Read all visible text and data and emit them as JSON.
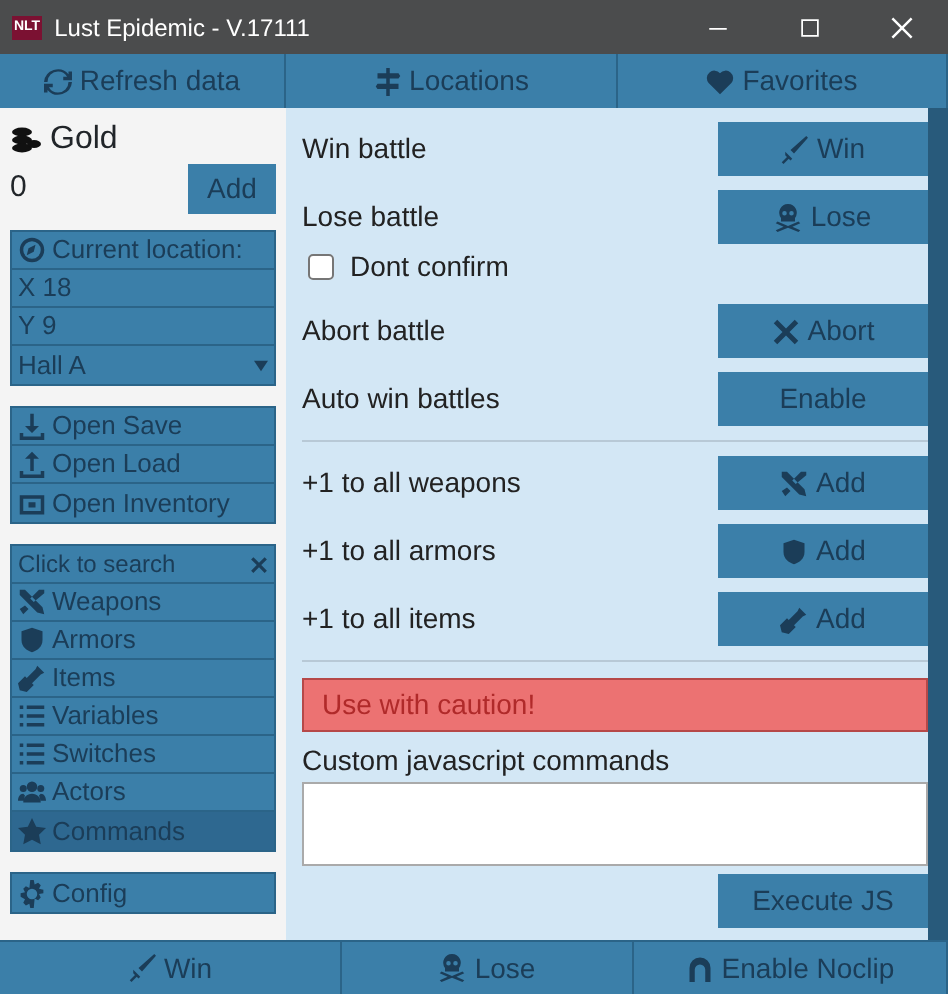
{
  "window": {
    "title": "Lust Epidemic - V.17111",
    "logo": "NLT"
  },
  "top_nav": [
    {
      "label": "Refresh data"
    },
    {
      "label": "Locations"
    },
    {
      "label": "Favorites"
    }
  ],
  "sidebar": {
    "gold": {
      "label": "Gold",
      "value": "0",
      "button": "Add"
    },
    "location": {
      "header": "Current location:",
      "x": "X 18",
      "y": "Y 9",
      "map": "Hall A"
    },
    "files": [
      {
        "label": "Open Save"
      },
      {
        "label": "Open Load"
      },
      {
        "label": "Open Inventory"
      }
    ],
    "search": {
      "placeholder": "Click to search"
    },
    "categories": [
      {
        "label": "Weapons",
        "selected": false
      },
      {
        "label": "Armors",
        "selected": false
      },
      {
        "label": "Items",
        "selected": false
      },
      {
        "label": "Variables",
        "selected": false
      },
      {
        "label": "Switches",
        "selected": false
      },
      {
        "label": "Actors",
        "selected": false
      },
      {
        "label": "Commands",
        "selected": true
      }
    ],
    "config": "Config"
  },
  "battle": [
    {
      "kind": "action",
      "label": "Win battle",
      "button": "Win"
    },
    {
      "kind": "action",
      "label": "Lose battle",
      "button": "Lose"
    },
    {
      "kind": "checkbox",
      "label": "Dont confirm",
      "checked": false
    },
    {
      "kind": "action",
      "label": "Abort battle",
      "button": "Abort"
    },
    {
      "kind": "action",
      "label": "Auto win battles",
      "button": "Enable"
    }
  ],
  "inventory": [
    {
      "label": "+1 to all weapons",
      "button": "Add"
    },
    {
      "label": "+1 to all armors",
      "button": "Add"
    },
    {
      "label": "+1 to all items",
      "button": "Add"
    }
  ],
  "alert": "Use with caution!",
  "custom_js": {
    "label": "Custom javascript commands",
    "button": "Execute JS"
  },
  "bottom_bar": [
    {
      "label": "Win"
    },
    {
      "label": "Lose"
    },
    {
      "label": "Enable Noclip"
    }
  ]
}
